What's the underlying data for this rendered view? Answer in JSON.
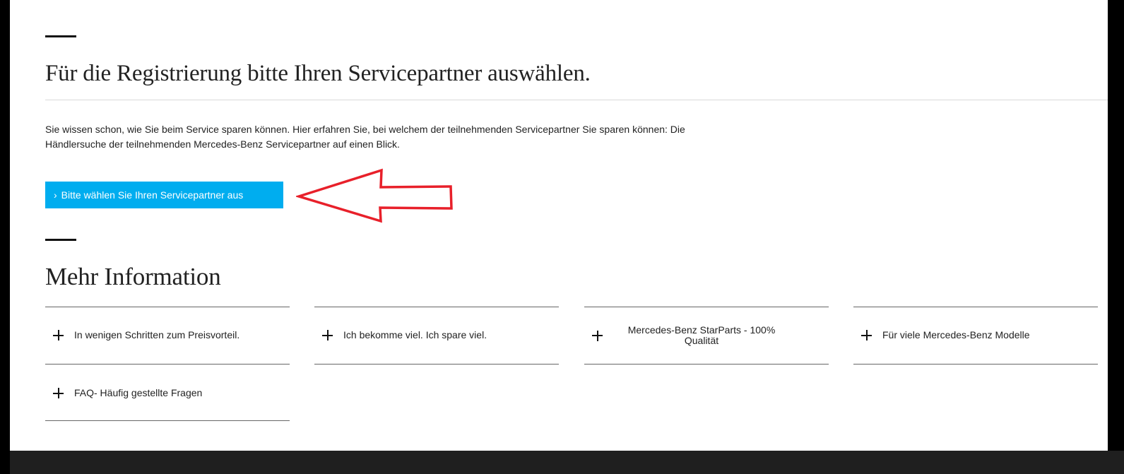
{
  "registration": {
    "title": "Für die Registrierung bitte Ihren Servicepartner auswählen.",
    "intro": "Sie wissen schon, wie Sie beim Service sparen können. Hier erfahren Sie, bei welchem der teilnehmenden Servicepartner Sie sparen können: Die Händlersuche der teilnehmenden Mercedes-Benz Servicepartner auf einen Blick.",
    "cta_chevron": "›",
    "cta_label": "Bitte wählen Sie Ihren Servicepartner aus"
  },
  "more_info": {
    "title": "Mehr Information",
    "items": [
      {
        "label": "In wenigen Schritten zum Preisvorteil."
      },
      {
        "label": "Ich bekomme viel. Ich spare viel."
      },
      {
        "label": "Mercedes-Benz StarParts - 100% Qualität"
      },
      {
        "label": "Für viele Mercedes-Benz Modelle"
      },
      {
        "label": "FAQ- Häufig gestellte Fragen"
      }
    ]
  },
  "colors": {
    "accent": "#00adef",
    "annotation_arrow": "#e8202a"
  },
  "icons": {
    "accordion": "plus-icon",
    "cta": "chevron-right-icon",
    "annotation": "arrow-left-icon"
  }
}
